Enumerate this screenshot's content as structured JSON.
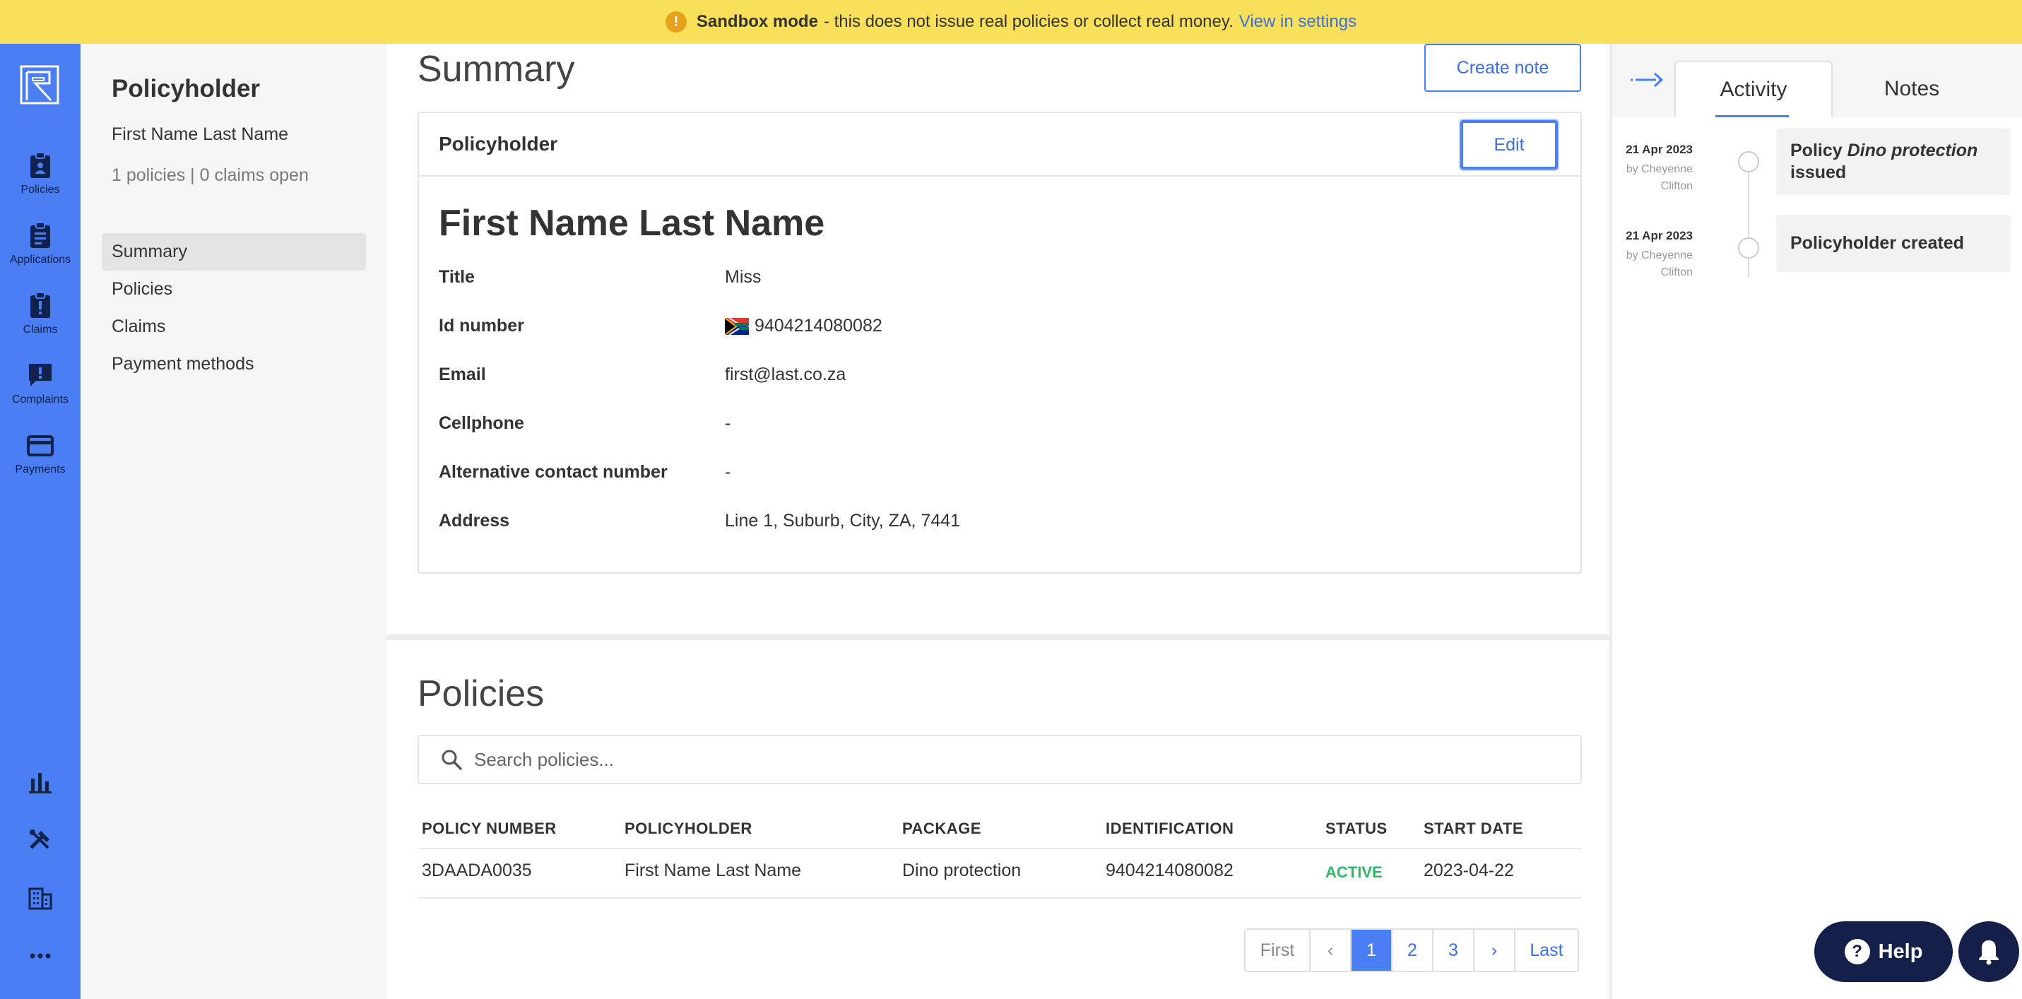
{
  "banner": {
    "strong": "Sandbox mode",
    "text": "- this does not issue real policies or collect real money.",
    "link": "View in settings",
    "icon": "warning-icon"
  },
  "rail": {
    "items": [
      {
        "label": "Policies",
        "icon": "policies-icon"
      },
      {
        "label": "Applications",
        "icon": "clipboard-icon"
      },
      {
        "label": "Claims",
        "icon": "claims-icon"
      },
      {
        "label": "Complaints",
        "icon": "complaint-icon"
      },
      {
        "label": "Payments",
        "icon": "credit-card-icon"
      }
    ],
    "bottom_icons": [
      "bar-chart-icon",
      "tools-icon",
      "building-icon",
      "more-icon"
    ]
  },
  "subnav": {
    "title": "Policyholder",
    "name": "First Name Last Name",
    "meta": "1 policies | 0 claims open",
    "items": [
      "Summary",
      "Policies",
      "Claims",
      "Payment methods"
    ],
    "active": "Summary"
  },
  "summary": {
    "heading": "Summary",
    "create_note": "Create note",
    "card_label": "Policyholder",
    "edit": "Edit",
    "full_name": "First Name Last Name",
    "fields": [
      {
        "key": "Title",
        "value": "Miss"
      },
      {
        "key": "Id number",
        "value": "9404214080082"
      },
      {
        "key": "Email",
        "value": "first@last.co.za"
      },
      {
        "key": "Cellphone",
        "value": "-"
      },
      {
        "key": "Alternative contact number",
        "value": "-"
      },
      {
        "key": "Address",
        "value": "Line 1, Suburb, City, ZA, 7441"
      }
    ]
  },
  "policies": {
    "heading": "Policies",
    "search_placeholder": "Search policies...",
    "columns": [
      "POLICY NUMBER",
      "POLICYHOLDER",
      "PACKAGE",
      "IDENTIFICATION",
      "STATUS",
      "START DATE"
    ],
    "rows": [
      [
        "3DAADA0035",
        "First Name Last Name",
        "Dino protection",
        "9404214080082",
        "ACTIVE",
        "2023-04-22"
      ]
    ],
    "pagination": {
      "first": "First",
      "prev": "‹",
      "pages": [
        "1",
        "2",
        "3"
      ],
      "next": "›",
      "last": "Last",
      "current": "1"
    }
  },
  "activity_panel": {
    "tabs": [
      "Activity",
      "Notes"
    ],
    "active_tab": "Activity",
    "events": [
      {
        "date": "21 Apr 2023",
        "by": "by Cheyenne Clifton",
        "pre": "Policy ",
        "em": "Dino protection",
        "post": "issued"
      },
      {
        "date": "21 Apr 2023",
        "by": "by Cheyenne Clifton",
        "pre": "Policyholder created",
        "em": "",
        "post": ""
      }
    ]
  },
  "help": {
    "label": "Help"
  },
  "colors": {
    "accent": "#4a7ef2",
    "banner": "#f8e05a",
    "status_active": "#2eb86b",
    "dark": "#14204a"
  }
}
